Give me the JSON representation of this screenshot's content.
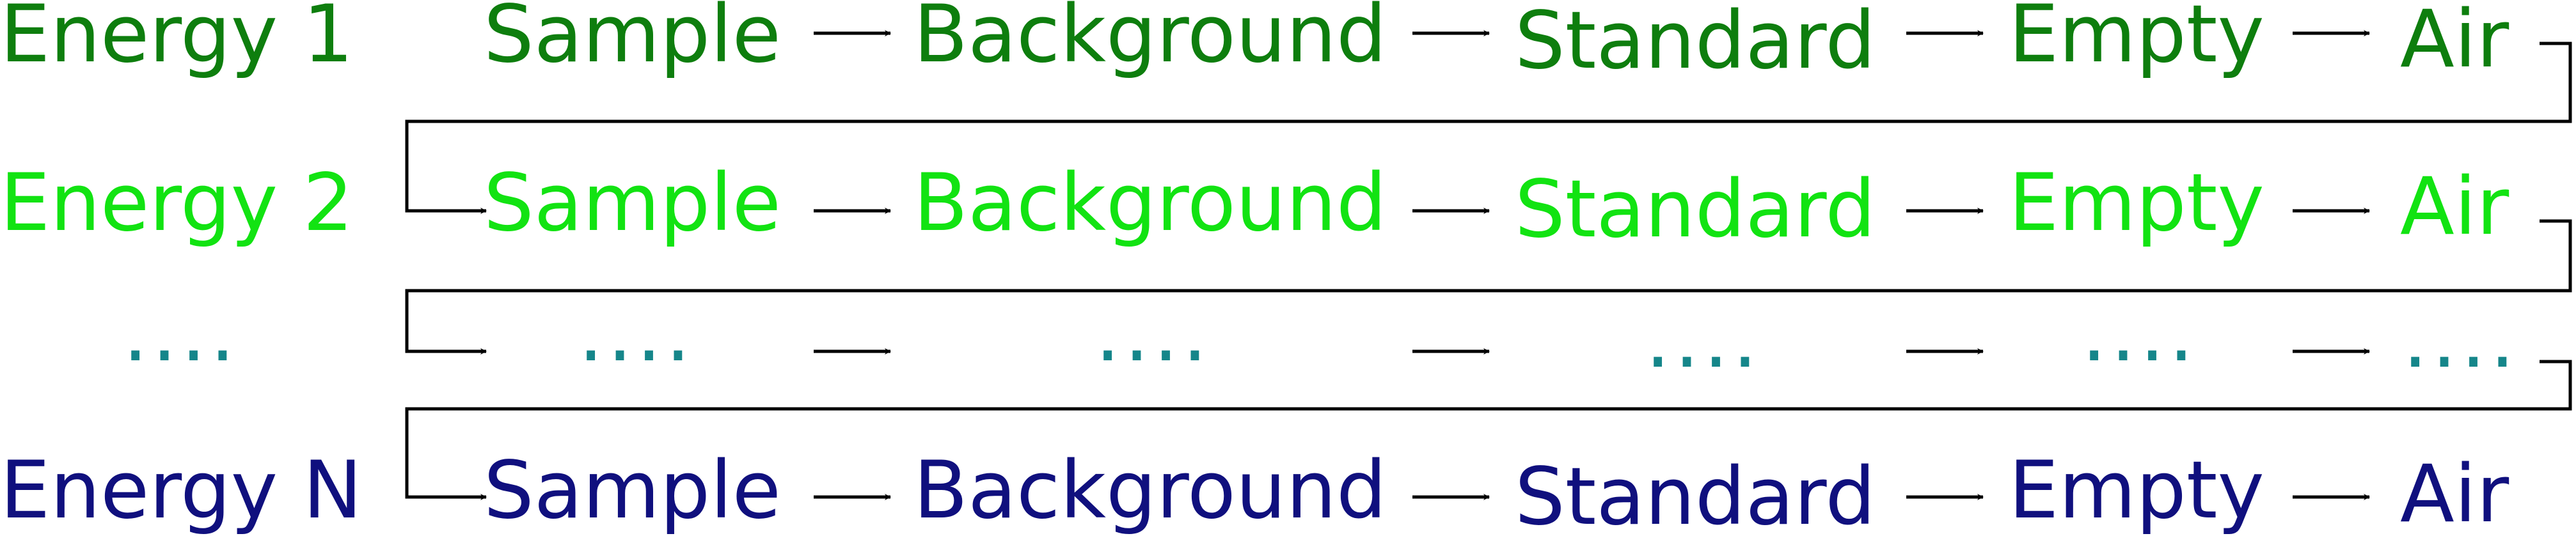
{
  "rows": [
    {
      "energy": "Energy 1",
      "color": "#0e7e0e",
      "steps": [
        "Sample",
        "Background",
        "Standard",
        "Empty",
        "Air"
      ]
    },
    {
      "energy": "Energy 2",
      "color": "#12e312",
      "steps": [
        "Sample",
        "Background",
        "Standard",
        "Empty",
        "Air"
      ]
    },
    {
      "energy": "....",
      "color": "#15868a",
      "steps": [
        "....",
        "....",
        "....",
        "....",
        "...."
      ]
    },
    {
      "energy": "Energy N",
      "color": "#10107e",
      "steps": [
        "Sample",
        "Background",
        "Standard",
        "Empty",
        "Air"
      ]
    }
  ],
  "connector_color": "#000000"
}
